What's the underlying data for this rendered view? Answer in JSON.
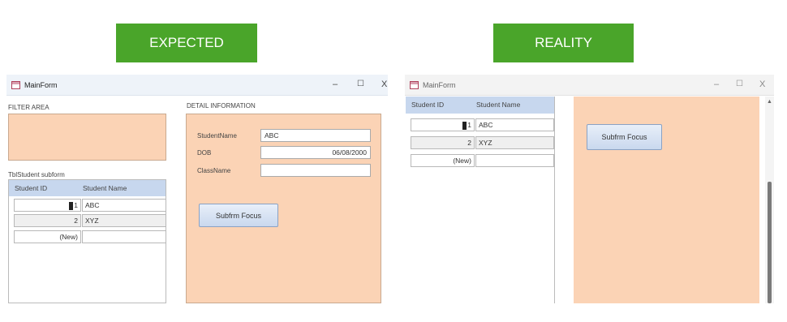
{
  "banners": {
    "expected": "EXPECTED",
    "reality": "REALITY"
  },
  "expected": {
    "window_title": "MainForm",
    "filter_area_label": "FILTER AREA",
    "detail_label": "DETAIL INFORMATION",
    "subform_label": "TblStudent subform",
    "columns": [
      "Student ID",
      "Student Name"
    ],
    "rows": [
      {
        "id": "1",
        "name": "ABC"
      },
      {
        "id": "2",
        "name": "XYZ"
      },
      {
        "id": "(New)",
        "name": ""
      }
    ],
    "fields": [
      {
        "label": "StudentName",
        "value": "ABC"
      },
      {
        "label": "DOB",
        "value": "06/08/2000"
      },
      {
        "label": "ClassName",
        "value": ""
      }
    ],
    "button_label": "Subfrm Focus"
  },
  "reality": {
    "window_title": "MainForm",
    "columns": [
      "Student ID",
      "Student Name"
    ],
    "rows": [
      {
        "id": "1",
        "name": "ABC"
      },
      {
        "id": "2",
        "name": "XYZ"
      },
      {
        "id": "(New)",
        "name": ""
      }
    ],
    "button_label": "Subfrm Focus"
  },
  "window_controls": {
    "minimize": "–",
    "maximize": "☐",
    "close": "X"
  },
  "colors": {
    "banner": "#4aa52a",
    "peach": "#fbd3b5",
    "header": "#c7d7ee"
  }
}
